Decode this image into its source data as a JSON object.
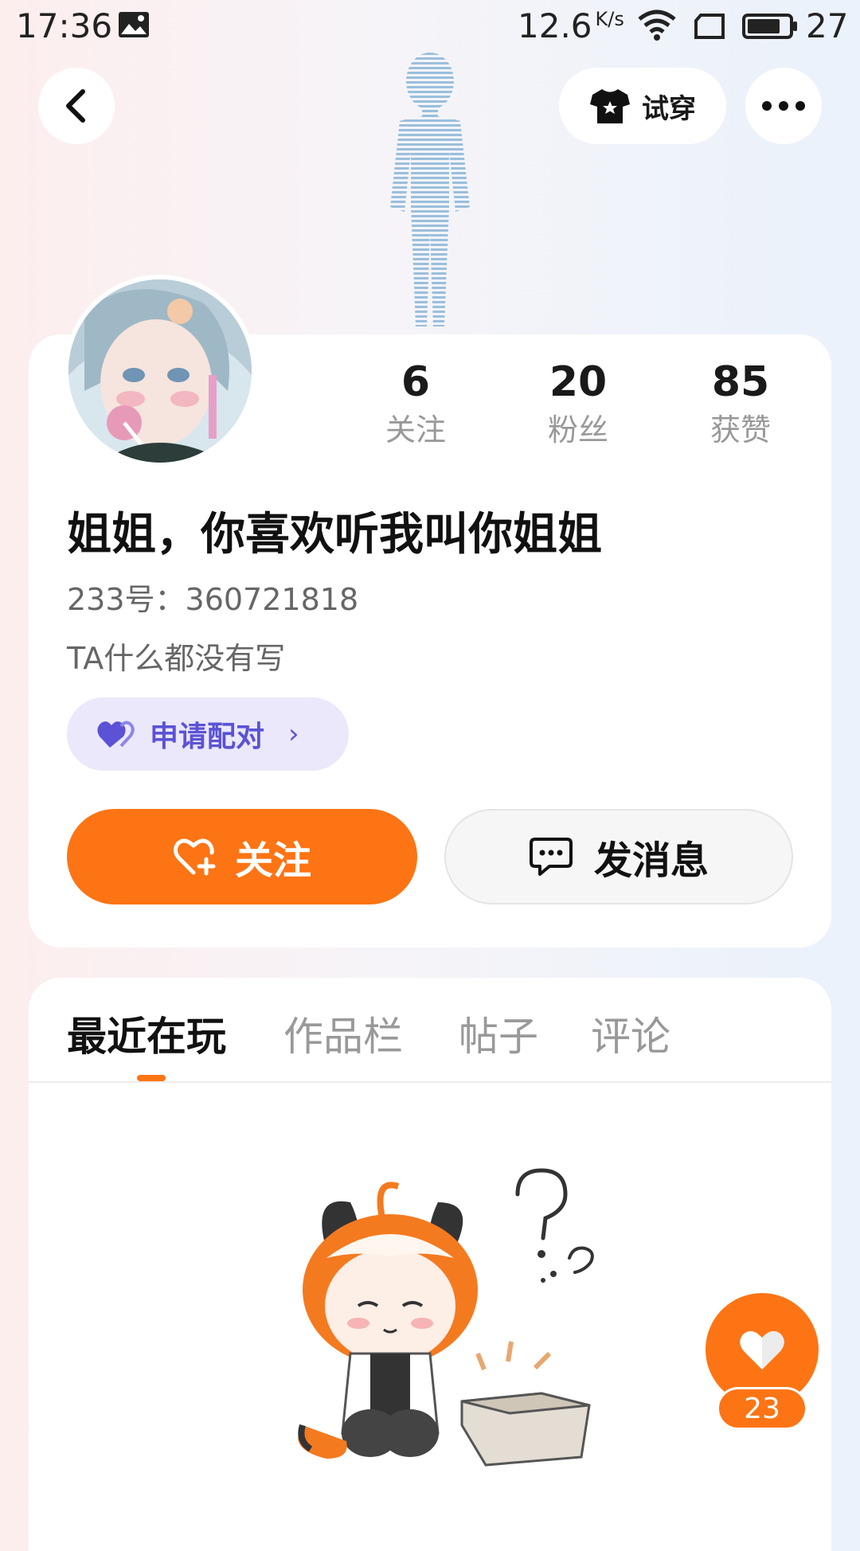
{
  "status_bar": {
    "time": "17:36",
    "net_speed": "12.6",
    "net_unit": "K/s",
    "battery": "27",
    "icons": [
      "gallery-icon",
      "wifi-icon",
      "sim-icon",
      "battery-icon"
    ]
  },
  "header": {
    "try_on_label": "试穿"
  },
  "profile": {
    "stats": [
      {
        "value": "6",
        "label": "关注"
      },
      {
        "value": "20",
        "label": "粉丝"
      },
      {
        "value": "85",
        "label": "获赞"
      }
    ],
    "username": "姐姐，你喜欢听我叫你姐姐",
    "uid": "233号：360721818",
    "bio": "TA什么都没有写",
    "pair_label": "申请配对",
    "follow_label": "关注",
    "message_label": "发消息"
  },
  "tabs": [
    {
      "label": "最近在玩",
      "active": true
    },
    {
      "label": "作品栏",
      "active": false
    },
    {
      "label": "帖子",
      "active": false
    },
    {
      "label": "评论",
      "active": false
    }
  ],
  "like_fab": {
    "count": "23"
  },
  "colors": {
    "accent": "#fd7414",
    "pair_text": "#5b52d6",
    "pair_bg": "#ebe8fb"
  }
}
